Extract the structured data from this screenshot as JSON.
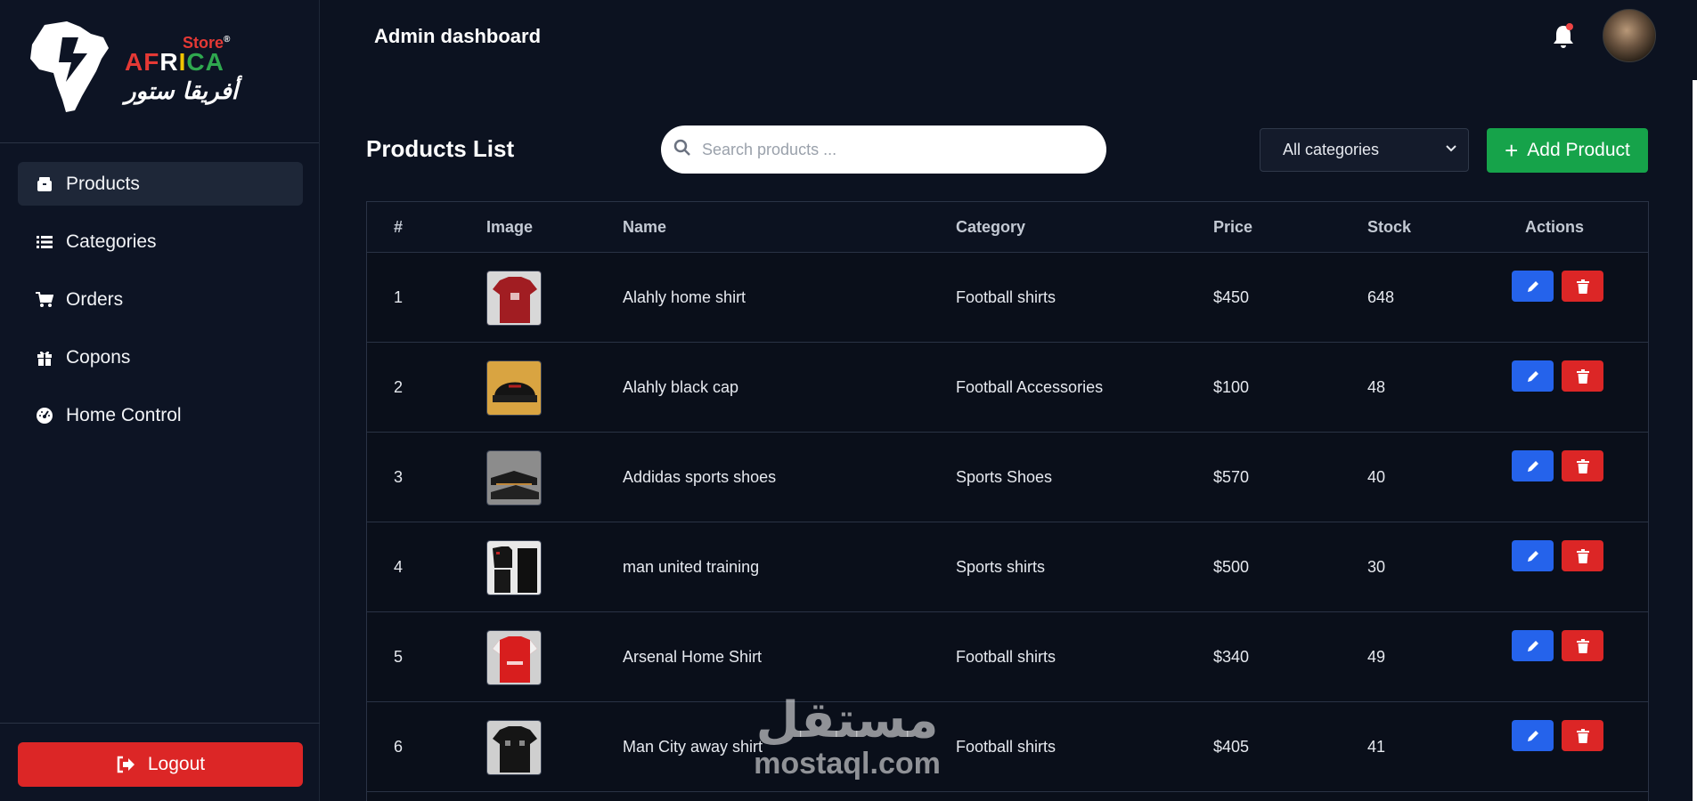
{
  "brand": {
    "store": "Store",
    "registered": "®",
    "africa": [
      "A",
      "F",
      "R",
      "I",
      "C",
      "A"
    ],
    "arabic": "أفريقا ستور",
    "colors": {
      "red": "#e53935",
      "yellow": "#f2c400",
      "green": "#2fa84f"
    }
  },
  "sidebar": {
    "items": [
      {
        "label": "Products",
        "icon": "box-icon",
        "active": true
      },
      {
        "label": "Categories",
        "icon": "list-icon",
        "active": false
      },
      {
        "label": "Orders",
        "icon": "cart-icon",
        "active": false
      },
      {
        "label": "Copons",
        "icon": "gift-icon",
        "active": false
      },
      {
        "label": "Home Control",
        "icon": "gauge-icon",
        "active": false
      }
    ],
    "logout_label": "Logout"
  },
  "header": {
    "title": "Admin dashboard"
  },
  "products": {
    "title": "Products List",
    "search_placeholder": "Search products ...",
    "category_filter": "All categories",
    "add_label": "Add Product",
    "columns": [
      "#",
      "Image",
      "Name",
      "Category",
      "Price",
      "Stock",
      "Actions"
    ],
    "rows": [
      {
        "id": "1",
        "name": "Alahly home shirt",
        "category": "Football shirts",
        "price": "$450",
        "stock": "648"
      },
      {
        "id": "2",
        "name": "Alahly black cap",
        "category": "Football Accessories",
        "price": "$100",
        "stock": "48"
      },
      {
        "id": "3",
        "name": "Addidas sports shoes",
        "category": "Sports Shoes",
        "price": "$570",
        "stock": "40"
      },
      {
        "id": "4",
        "name": "man united training",
        "category": "Sports shirts",
        "price": "$500",
        "stock": "30"
      },
      {
        "id": "5",
        "name": "Arsenal Home Shirt",
        "category": "Football shirts",
        "price": "$340",
        "stock": "49"
      },
      {
        "id": "6",
        "name": "Man City away shirt",
        "category": "Football shirts",
        "price": "$405",
        "stock": "41"
      }
    ]
  },
  "watermark": {
    "arabic": "مستقل",
    "latin": "mostaql.com"
  },
  "colors": {
    "primary": "#2563eb",
    "danger": "#dc2626",
    "success": "#16a34a",
    "background": "#0c1220"
  }
}
